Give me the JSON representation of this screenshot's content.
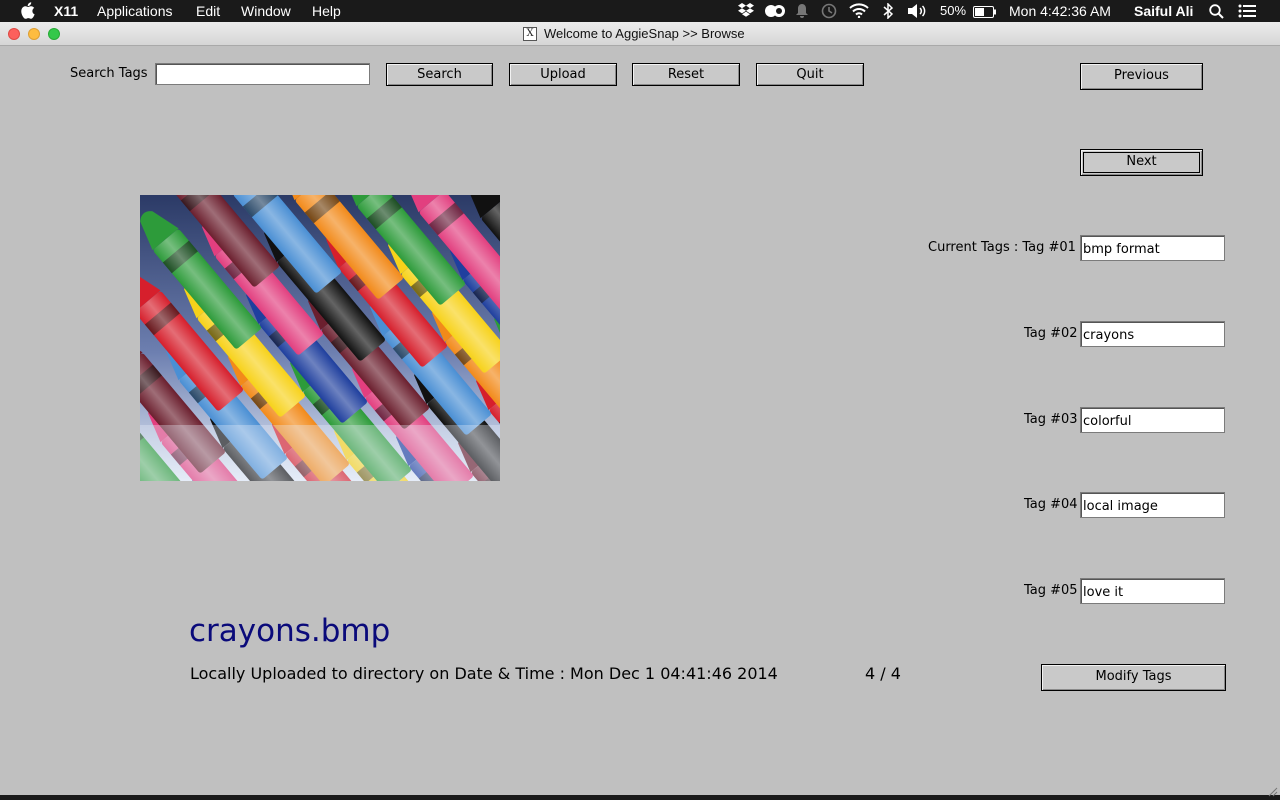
{
  "menubar": {
    "app": "X11",
    "items": [
      "Applications",
      "Edit",
      "Window",
      "Help"
    ],
    "battery": "50%",
    "clock": "Mon 4:42:36 AM",
    "user": "Saiful Ali"
  },
  "window": {
    "title": "Welcome to AggieSnap >> Browse",
    "x_glyph": "X"
  },
  "toolbar": {
    "search_label": "Search Tags",
    "search_value": "",
    "search_button": "Search",
    "upload_button": "Upload",
    "reset_button": "Reset",
    "quit_button": "Quit"
  },
  "nav": {
    "previous_button": "Previous",
    "next_button": "Next"
  },
  "tags": {
    "current_label": "Current Tags : Tag #01",
    "items": [
      {
        "label": "Tag #02",
        "value": "crayons"
      },
      {
        "label": "Tag #03",
        "value": "colorful"
      },
      {
        "label": "Tag #04",
        "value": "local image"
      },
      {
        "label": "Tag #05",
        "value": "love it"
      }
    ],
    "first_value": "bmp format",
    "modify_button": "Modify Tags"
  },
  "image": {
    "subject": "crayons-photo",
    "crayon_colors": [
      "#d61f2c",
      "#f28a1a",
      "#f7d21a",
      "#2d9b3a",
      "#1f3f9e",
      "#e23f7f",
      "#6b1f2e",
      "#111111",
      "#4a8fd4"
    ]
  },
  "info": {
    "filename": "crayons.bmp",
    "upload_text": "Locally Uploaded to directory on Date & Time : Mon Dec  1 04:41:46 2014",
    "counter": "4 / 4"
  },
  "colors": {
    "background": "#c0c0c0",
    "filename": "#0a0a7a",
    "close": "#fc605c",
    "minimize": "#fdbc40",
    "zoom": "#34c84a"
  }
}
